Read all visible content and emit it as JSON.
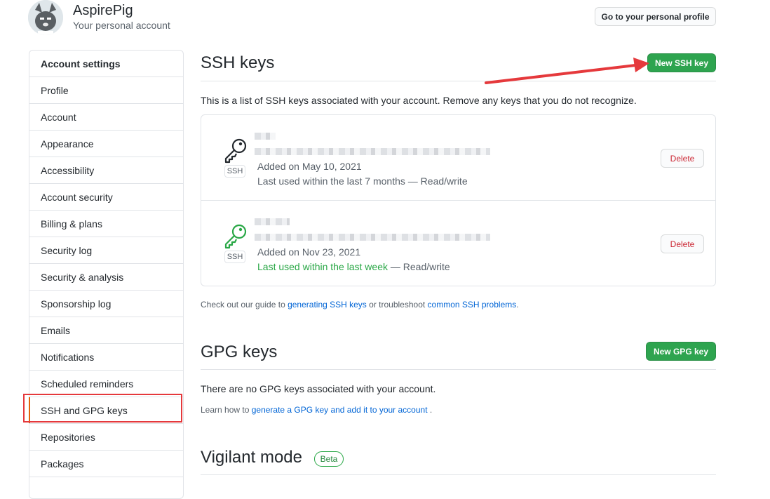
{
  "account": {
    "name": "AspirePig",
    "subtitle": "Your personal account",
    "profile_button": "Go to your personal profile"
  },
  "sidebar": {
    "header": "Account settings",
    "items": [
      {
        "label": "Profile"
      },
      {
        "label": "Account"
      },
      {
        "label": "Appearance"
      },
      {
        "label": "Accessibility"
      },
      {
        "label": "Account security"
      },
      {
        "label": "Billing & plans"
      },
      {
        "label": "Security log"
      },
      {
        "label": "Security & analysis"
      },
      {
        "label": "Sponsorship log"
      },
      {
        "label": "Emails"
      },
      {
        "label": "Notifications"
      },
      {
        "label": "Scheduled reminders"
      },
      {
        "label": "SSH and GPG keys",
        "selected": true
      },
      {
        "label": "Repositories"
      },
      {
        "label": "Packages"
      }
    ]
  },
  "ssh": {
    "title": "SSH keys",
    "new_button": "New SSH key",
    "description": "This is a list of SSH keys associated with your account. Remove any keys that you do not recognize.",
    "keys": [
      {
        "badge": "SSH",
        "added": "Added on May 10, 2021",
        "last_used": "Last used within the last 7 months",
        "access": " — Read/write",
        "recent": false,
        "delete_label": "Delete",
        "icon": "key-icon"
      },
      {
        "badge": "SSH",
        "added": "Added on Nov 23, 2021",
        "last_used": "Last used within the last week",
        "access": " — Read/write",
        "recent": true,
        "delete_label": "Delete",
        "icon": "key-icon"
      }
    ],
    "guide": {
      "prefix": "Check out our guide to ",
      "link1": "generating SSH keys",
      "middle": " or troubleshoot ",
      "link2": "common SSH problems",
      "suffix": "."
    }
  },
  "gpg": {
    "title": "GPG keys",
    "new_button": "New GPG key",
    "empty": "There are no GPG keys associated with your account.",
    "learn_prefix": "Learn how to ",
    "learn_link": "generate a GPG key and add it to your account",
    "learn_suffix": " ."
  },
  "vigilant": {
    "title": "Vigilant mode",
    "badge": "Beta"
  },
  "colors": {
    "green": "#2ea44f",
    "link": "#0366d6",
    "danger": "#cb2431",
    "annotation_red": "#e5393c"
  }
}
